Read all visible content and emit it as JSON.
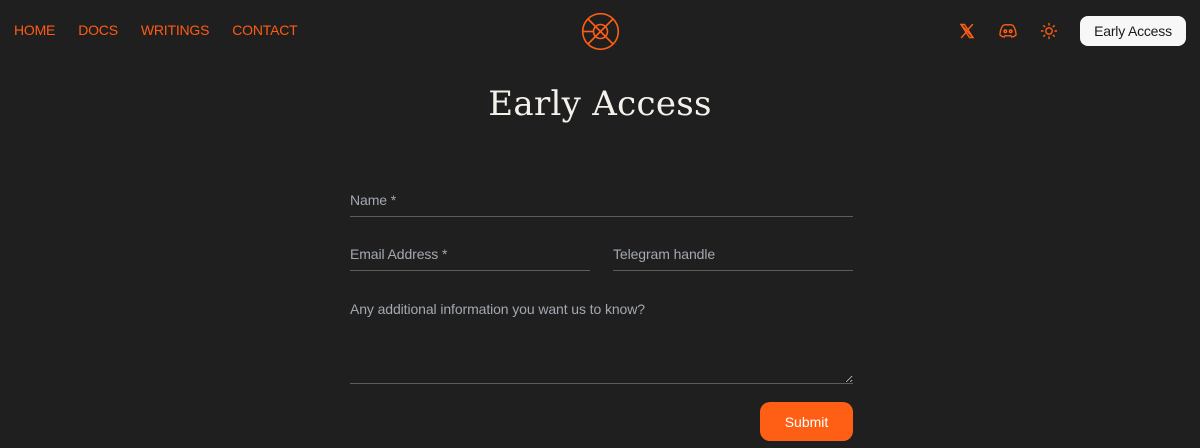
{
  "nav": {
    "links": [
      {
        "label": "HOME"
      },
      {
        "label": "DOCS"
      },
      {
        "label": "WRITINGS"
      },
      {
        "label": "CONTACT"
      }
    ],
    "icons": [
      "x-twitter-icon",
      "discord-icon",
      "sun-theme-icon"
    ],
    "cta_label": "Early Access"
  },
  "logo": "orbit-logo-icon",
  "page": {
    "title": "Early Access"
  },
  "form": {
    "name_placeholder": "Name *",
    "name_value": "",
    "email_placeholder": "Email Address *",
    "email_value": "",
    "telegram_placeholder": "Telegram handle",
    "telegram_value": "",
    "info_placeholder": "Any additional information you want us to know?",
    "info_value": "",
    "submit_label": "Submit"
  },
  "colors": {
    "background": "#1f1f1f",
    "accent": "#ff5f14",
    "cta_background": "#f7f7f7",
    "placeholder": "#a3a8b0",
    "title": "#f4f1ea"
  }
}
